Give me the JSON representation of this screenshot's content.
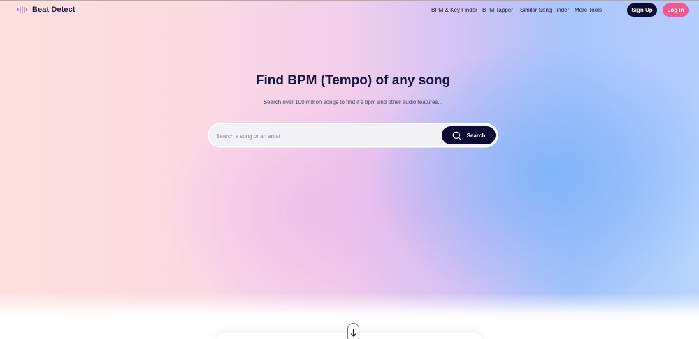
{
  "brand": {
    "name": "Beat Detect"
  },
  "nav": {
    "links": [
      {
        "label": "BPM & Key Finder"
      },
      {
        "label": "BPM Tapper"
      },
      {
        "label": "Similar Song Finder"
      },
      {
        "label": "More Tools"
      }
    ],
    "signup_label": "Sign Up",
    "login_label": "Log in"
  },
  "hero": {
    "title": "Find BPM (Tempo) of any song",
    "subtitle": "Search over 100 million songs to find it's bpm and other audio features...",
    "search": {
      "placeholder": "Search a song or an artist",
      "value": "",
      "button_label": "Search"
    }
  },
  "colors": {
    "primary_dark": "#0e0b33",
    "accent_pink": "#f2588f",
    "logo_purple": "#7b5cf0"
  },
  "icons": {
    "logo": "sound-wave-icon",
    "search": "search-icon",
    "scroll": "arrow-down-icon"
  }
}
